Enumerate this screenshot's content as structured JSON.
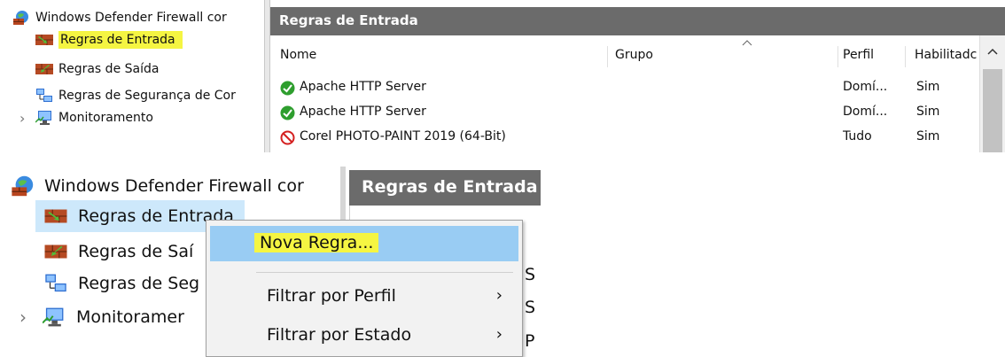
{
  "panel1": {
    "tree": {
      "root_label": "Windows Defender Firewall cor",
      "items": [
        {
          "label": "Regras de Entrada",
          "icon": "inbound-rules-icon",
          "highlighted": true
        },
        {
          "label": "Regras de Saída",
          "icon": "outbound-rules-icon"
        },
        {
          "label": "Regras de Segurança de Cor",
          "icon": "connection-security-icon"
        },
        {
          "label": "Monitoramento",
          "icon": "monitor-icon",
          "expander": "›"
        }
      ]
    },
    "header": {
      "title": "Regras de Entrada"
    },
    "columns": {
      "nome": "Nome",
      "grupo": "Grupo",
      "perfil": "Perfil",
      "habilitado": "Habilitadc"
    },
    "rows": [
      {
        "name": "Apache HTTP Server",
        "profile": "Domí...",
        "enabled": "Sim",
        "status": "allow"
      },
      {
        "name": "Apache HTTP Server",
        "profile": "Domí...",
        "enabled": "Sim",
        "status": "allow"
      },
      {
        "name": "Corel PHOTO-PAINT 2019 (64-Bit)",
        "profile": "Tudo",
        "enabled": "Sim",
        "status": "block"
      }
    ]
  },
  "panel2": {
    "tree": {
      "root_label": "Windows Defender Firewall cor",
      "items": [
        {
          "label": "Regras de Entrada"
        },
        {
          "label": "Regras de Saí"
        },
        {
          "label": "Regras de Seg"
        },
        {
          "label": "Monitoramer",
          "expander": "›"
        }
      ]
    },
    "header": {
      "title": "Regras de Entrada"
    },
    "context_menu": {
      "items": [
        {
          "label": "Nova Regra...",
          "highlighted": true
        },
        {
          "label": "Filtrar por Perfil",
          "submenu_arrow": "›"
        },
        {
          "label": "Filtrar por Estado",
          "submenu_arrow": "›"
        }
      ]
    },
    "behind_fragments": [
      "S",
      "S",
      "P"
    ]
  },
  "colors": {
    "header_bar": "#6b6b6b",
    "highlight_yellow": "#f5f542",
    "selection_blue": "#99ccf3",
    "allow_green": "#2e9e2e",
    "block_red": "#d42020"
  }
}
